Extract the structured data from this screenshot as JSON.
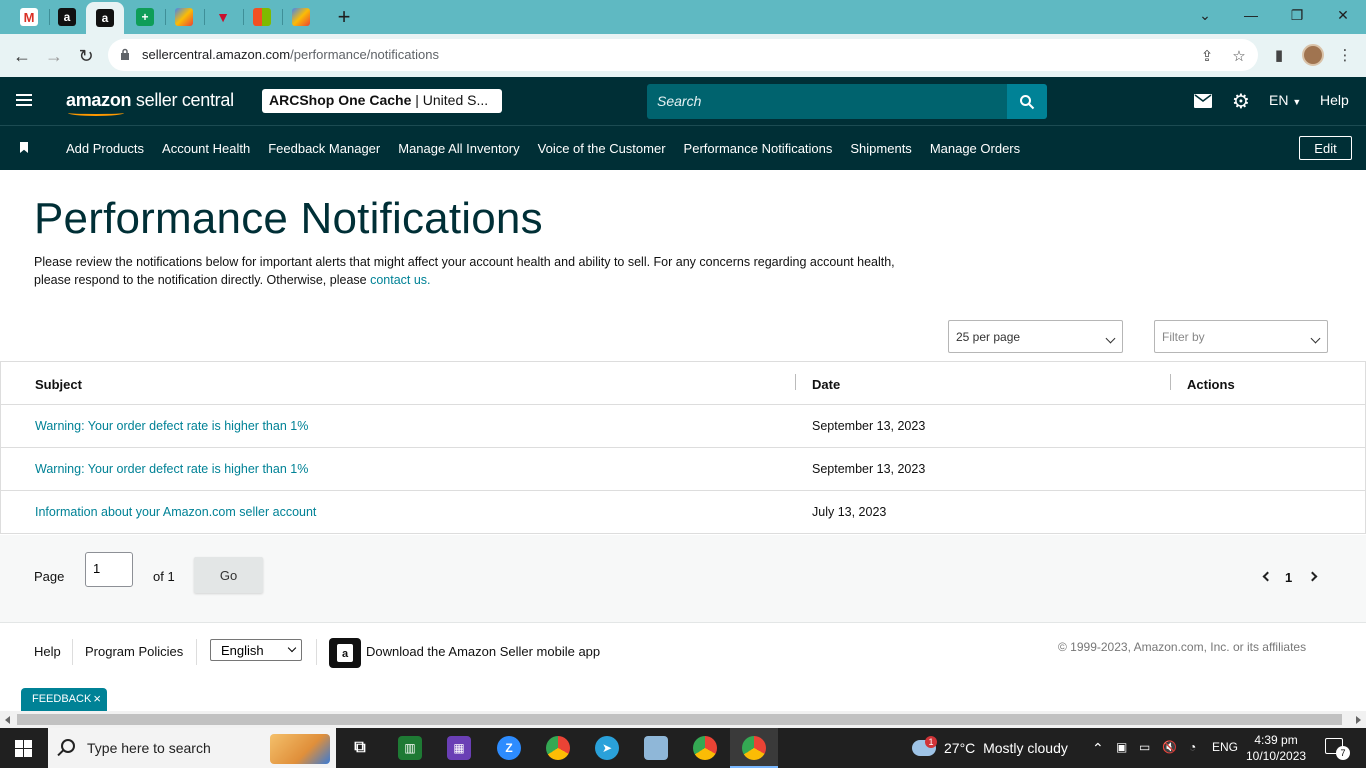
{
  "browser": {
    "url_domain": "sellercentral.amazon.com",
    "url_path": "/performance/notifications"
  },
  "header": {
    "logo_brand": "amazon",
    "logo_product": "seller central",
    "store_name": "ARCShop One Cache",
    "store_region": " | United S...",
    "search_placeholder": "Search",
    "language": "EN",
    "help": "Help"
  },
  "nav": {
    "items": [
      "Add Products",
      "Account Health",
      "Feedback Manager",
      "Manage All Inventory",
      "Voice of the Customer",
      "Performance Notifications",
      "Shipments",
      "Manage Orders"
    ],
    "edit": "Edit"
  },
  "main": {
    "title": "Performance Notifications",
    "intro_text": "Please review the notifications below for important alerts that might affect your account health and ability to sell. For any concerns regarding account health, please respond to the notification directly. Otherwise, please ",
    "intro_link": "contact us.",
    "per_page": "25 per page",
    "filter_placeholder": "Filter by"
  },
  "table": {
    "columns": [
      "Subject",
      "Date",
      "Actions"
    ],
    "rows": [
      {
        "subject": "Warning: Your order defect rate is higher than 1%",
        "date": "September 13, 2023"
      },
      {
        "subject": "Warning: Your order defect rate is higher than 1%",
        "date": "September 13, 2023"
      },
      {
        "subject": "Information about your Amazon.com seller account",
        "date": "July 13, 2023"
      }
    ]
  },
  "pagination": {
    "page_label": "Page",
    "page_value": "1",
    "of_label": "of 1",
    "go": "Go",
    "current": "1"
  },
  "footer": {
    "help": "Help",
    "program_policies": "Program Policies",
    "language": "English",
    "download_app": "Download the Amazon Seller mobile app",
    "copyright": "© 1999-2023, Amazon.com, Inc. or its affiliates"
  },
  "feedback": "FEEDBACK",
  "taskbar": {
    "search_placeholder": "Type here to search",
    "weather_temp": "27°C",
    "weather_text": "Mostly cloudy",
    "weather_badge": "1",
    "input_lang": "ENG",
    "time": "4:39 pm",
    "date": "10/10/2023",
    "notification_count": "7"
  },
  "colors": {
    "header_bg": "#002f36",
    "link": "#008296",
    "tabstrip": "#5fb9c2"
  }
}
